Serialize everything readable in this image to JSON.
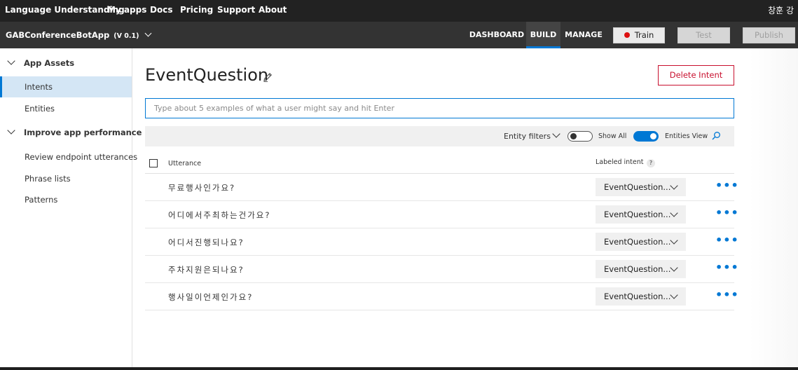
{
  "topnav": {
    "links": [
      "Language Understanding",
      "My apps",
      "Docs",
      "Pricing",
      "Support",
      "About"
    ],
    "user": "창훈 강"
  },
  "appbar": {
    "app_name": "GABConferenceBotApp",
    "version": "(V 0.1)",
    "tabs": [
      "DASHBOARD",
      "BUILD",
      "MANAGE"
    ],
    "active_tab": "BUILD",
    "train_label": "Train",
    "test_label": "Test",
    "publish_label": "Publish"
  },
  "sidebar": {
    "sections": [
      {
        "label": "App Assets",
        "items": [
          "Intents",
          "Entities"
        ]
      },
      {
        "label": "Improve app performance",
        "items": [
          "Review endpoint utterances",
          "Phrase lists",
          "Patterns"
        ]
      }
    ],
    "active_item": "Intents"
  },
  "main": {
    "title": "EventQuestion",
    "delete_label": "Delete Intent",
    "input_placeholder": "Type about 5 examples of what a user might say and hit Enter",
    "input_value": ""
  },
  "filters": {
    "entity_filters_label": "Entity filters",
    "show_all_label": "Show All",
    "show_all_on": false,
    "entities_view_label": "Entities View",
    "entities_view_on": true
  },
  "table": {
    "col_utterance": "Utterance",
    "col_intent": "Labeled intent",
    "help_glyph": "?",
    "rows": [
      {
        "utterance": "무료행사인가요?",
        "intent": "EventQuestion..."
      },
      {
        "utterance": "어디에서주최하는건가요?",
        "intent": "EventQuestion..."
      },
      {
        "utterance": "어디서진행되나요?",
        "intent": "EventQuestion..."
      },
      {
        "utterance": "주차지원은되나요?",
        "intent": "EventQuestion..."
      },
      {
        "utterance": "행사일이언제인가요?",
        "intent": "EventQuestion..."
      }
    ],
    "more_glyph": "•••"
  },
  "colors": {
    "accent": "#0078d4",
    "danger": "#c8102e",
    "train_dot": "#dd1111"
  }
}
